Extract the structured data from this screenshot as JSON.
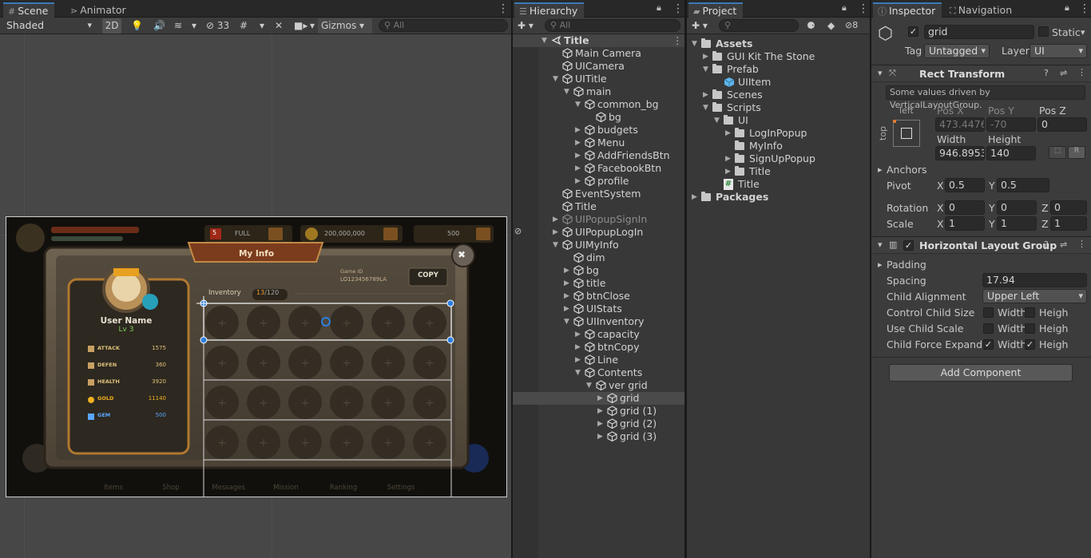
{
  "scene": {
    "tabs": [
      "Scene",
      "Animator"
    ],
    "shading_mode": "Shaded",
    "mode_2d": "2D",
    "hidden_count": "33",
    "gizmos_label": "Gizmos",
    "search_placeholder": "All",
    "game": {
      "title": "My Info",
      "close": "✖",
      "user_name": "User Name",
      "level": "Lv 3",
      "stats": [
        {
          "label": "ATTACK",
          "value": "1575",
          "color": "#e0c07a"
        },
        {
          "label": "DEFEN",
          "value": "360",
          "color": "#e0c07a"
        },
        {
          "label": "HEALTH",
          "value": "3920",
          "color": "#e0c07a"
        },
        {
          "label": "GOLD",
          "value": "11140",
          "color": "#f0b020"
        },
        {
          "label": "GEM",
          "value": "500",
          "color": "#5aa7ff"
        }
      ],
      "game_id_label": "Game ID",
      "game_id": "LO123456789LA",
      "copy_label": "COPY",
      "inventory_label": "Inventory",
      "inventory_used": "13",
      "inventory_total": "/120",
      "top_hp": "FULL",
      "top_gold": "200,000,000",
      "top_gem": "500",
      "top_badge": "5",
      "nav": [
        "Items",
        "Shop",
        "Messages",
        "Mission",
        "Ranking",
        "Settings"
      ]
    }
  },
  "hierarchy": {
    "tab": "Hierarchy",
    "search_placeholder": "All",
    "items": [
      {
        "label": "Title",
        "depth": 0,
        "arrow": "down",
        "icon": "unity-scene-icon",
        "root": true
      },
      {
        "label": "Main Camera",
        "depth": 1,
        "arrow": "none"
      },
      {
        "label": "UICamera",
        "depth": 1,
        "arrow": "none"
      },
      {
        "label": "UITitle",
        "depth": 1,
        "arrow": "down"
      },
      {
        "label": "main",
        "depth": 2,
        "arrow": "down"
      },
      {
        "label": "common_bg",
        "depth": 3,
        "arrow": "down"
      },
      {
        "label": "bg",
        "depth": 4,
        "arrow": "none"
      },
      {
        "label": "budgets",
        "depth": 3,
        "arrow": "right"
      },
      {
        "label": "Menu",
        "depth": 3,
        "arrow": "right"
      },
      {
        "label": "AddFriendsBtn",
        "depth": 3,
        "arrow": "right"
      },
      {
        "label": "FacebookBtn",
        "depth": 3,
        "arrow": "right"
      },
      {
        "label": "profile",
        "depth": 3,
        "arrow": "right"
      },
      {
        "label": "EventSystem",
        "depth": 1,
        "arrow": "none"
      },
      {
        "label": "Title",
        "depth": 1,
        "arrow": "none"
      },
      {
        "label": "UIPopupSignIn",
        "depth": 1,
        "arrow": "right",
        "dim": true
      },
      {
        "label": "UIPopupLogIn",
        "depth": 1,
        "arrow": "right"
      },
      {
        "label": "UIMyInfo",
        "depth": 1,
        "arrow": "down"
      },
      {
        "label": "dim",
        "depth": 2,
        "arrow": "none"
      },
      {
        "label": "bg",
        "depth": 2,
        "arrow": "right"
      },
      {
        "label": "title",
        "depth": 2,
        "arrow": "right"
      },
      {
        "label": "btnClose",
        "depth": 2,
        "arrow": "right"
      },
      {
        "label": "UIStats",
        "depth": 2,
        "arrow": "right"
      },
      {
        "label": "UIInventory",
        "depth": 2,
        "arrow": "down"
      },
      {
        "label": "capacity",
        "depth": 3,
        "arrow": "right"
      },
      {
        "label": "btnCopy",
        "depth": 3,
        "arrow": "right"
      },
      {
        "label": "Line",
        "depth": 3,
        "arrow": "right"
      },
      {
        "label": "Contents",
        "depth": 3,
        "arrow": "down"
      },
      {
        "label": "ver grid",
        "depth": 4,
        "arrow": "down"
      },
      {
        "label": "grid",
        "depth": 5,
        "arrow": "right",
        "selected": true
      },
      {
        "label": "grid (1)",
        "depth": 5,
        "arrow": "right"
      },
      {
        "label": "grid (2)",
        "depth": 5,
        "arrow": "right"
      },
      {
        "label": "grid (3)",
        "depth": 5,
        "arrow": "right"
      }
    ]
  },
  "project": {
    "tab": "Project",
    "hidden_count": "8",
    "items": [
      {
        "label": "Assets",
        "depth": 0,
        "arrow": "down",
        "icon": "folder",
        "bold": true
      },
      {
        "label": "GUI Kit The Stone",
        "depth": 1,
        "arrow": "right",
        "icon": "folder"
      },
      {
        "label": "Prefab",
        "depth": 1,
        "arrow": "down",
        "icon": "folder"
      },
      {
        "label": "UIItem",
        "depth": 2,
        "arrow": "none",
        "icon": "prefab"
      },
      {
        "label": "Scenes",
        "depth": 1,
        "arrow": "right",
        "icon": "folder"
      },
      {
        "label": "Scripts",
        "depth": 1,
        "arrow": "down",
        "icon": "folder"
      },
      {
        "label": "UI",
        "depth": 2,
        "arrow": "down",
        "icon": "folder"
      },
      {
        "label": "LogInPopup",
        "depth": 3,
        "arrow": "right",
        "icon": "folder"
      },
      {
        "label": "MyInfo",
        "depth": 3,
        "arrow": "none",
        "icon": "folder"
      },
      {
        "label": "SignUpPopup",
        "depth": 3,
        "arrow": "right",
        "icon": "folder"
      },
      {
        "label": "Title",
        "depth": 3,
        "arrow": "right",
        "icon": "folder"
      },
      {
        "label": "Title",
        "depth": 2,
        "arrow": "none",
        "icon": "script"
      },
      {
        "label": "Packages",
        "depth": 0,
        "arrow": "right",
        "icon": "folder",
        "bold": true
      }
    ]
  },
  "inspector": {
    "tabs": [
      "Inspector",
      "Navigation"
    ],
    "object_name": "grid",
    "static_label": "Static",
    "tag_label": "Tag",
    "tag_value": "Untagged",
    "layer_label": "Layer",
    "layer_value": "UI",
    "rect_transform": {
      "title": "Rect Transform",
      "note": "Some values driven by VerticalLayoutGroup.",
      "anchor_h": "left",
      "anchor_v": "top",
      "pos_x_label": "Pos X",
      "pos_x": "473.4476",
      "pos_y_label": "Pos Y",
      "pos_y": "-70",
      "pos_z_label": "Pos Z",
      "pos_z": "0",
      "width_label": "Width",
      "width": "946.8953",
      "height_label": "Height",
      "height": "140",
      "r_label": "R",
      "anchors_label": "Anchors",
      "pivot_label": "Pivot",
      "pivot_x": "0.5",
      "pivot_y": "0.5",
      "rotation_label": "Rotation",
      "rot_x": "0",
      "rot_y": "0",
      "rot_z": "0",
      "scale_label": "Scale",
      "scale_x": "1",
      "scale_y": "1",
      "scale_z": "1",
      "x": "X",
      "y": "Y",
      "z": "Z"
    },
    "layout_group": {
      "title": "Horizontal Layout Group",
      "padding_label": "Padding",
      "spacing_label": "Spacing",
      "spacing": "17.94",
      "child_alignment_label": "Child Alignment",
      "child_alignment": "Upper Left",
      "control_child_size_label": "Control Child Size",
      "use_child_scale_label": "Use Child Scale",
      "child_force_expand_label": "Child Force Expand",
      "width_label": "Width",
      "height_label": "Heigh"
    },
    "add_component": "Add Component"
  }
}
